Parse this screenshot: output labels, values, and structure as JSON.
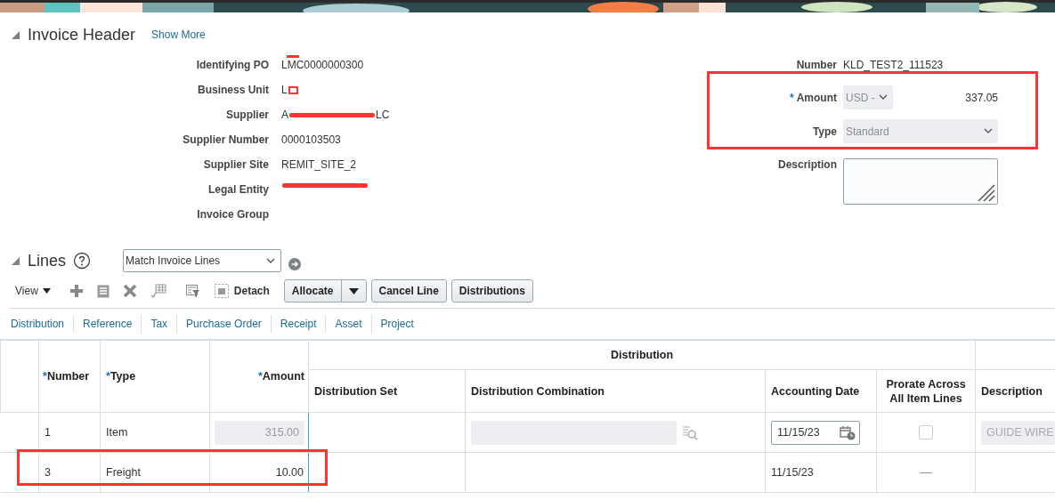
{
  "header": {
    "title": "Invoice Header",
    "expanded": true,
    "link": "Show More"
  },
  "left_fields": [
    {
      "kind": "redact-top",
      "label": "Identifying PO",
      "value": "LMC0000000300"
    },
    {
      "kind": "redact-box",
      "label": "Business Unit",
      "value": "L"
    },
    {
      "kind": "redact-strike",
      "label": "Supplier",
      "value": "A",
      "value_after": "LC"
    },
    {
      "kind": "plain",
      "label": "Supplier Number",
      "value": "0000103503"
    },
    {
      "kind": "plain",
      "label": "Supplier Site",
      "value": "REMIT_SITE_2"
    },
    {
      "kind": "redact-strike",
      "label": "Legal Entity"
    },
    {
      "kind": "plain",
      "label": "Invoice Group"
    }
  ],
  "right_fields": [
    {
      "kind": "text",
      "label": "Number",
      "value": "KLD_TEST2_111523",
      "highlighted": false
    },
    {
      "kind": "amount",
      "label": "Amount",
      "required_mark": "*",
      "currency": "USD -",
      "value": "337.05",
      "disabled": true,
      "highlighted": true
    },
    {
      "kind": "select",
      "label": "Type",
      "value": "Standard",
      "disabled": true,
      "highlighted": true
    },
    {
      "kind": "textarea",
      "label": "Description",
      "highlighted": false
    }
  ],
  "lines": {
    "title": "Lines",
    "expanded": true,
    "action_select": "Match Invoice Lines",
    "toolbar": {
      "view": "View",
      "detach": "Detach",
      "buttons": [
        {
          "label": "Allocate",
          "kind": "split"
        },
        {
          "label": "Cancel Line",
          "kind": "plain"
        },
        {
          "label": "Distributions",
          "kind": "plain"
        }
      ]
    },
    "tabs": [
      "Distribution",
      "Reference",
      "Tax",
      "Purchase Order",
      "Receipt",
      "Asset",
      "Project"
    ],
    "table": {
      "group_heading": "Distribution",
      "columns": [
        {
          "label": "Number",
          "required_mark": "*"
        },
        {
          "label": "Type",
          "required_mark": "*"
        },
        {
          "label": "Amount",
          "required_mark": "*"
        },
        {
          "label": "Distribution Set"
        },
        {
          "label": "Distribution Combination"
        },
        {
          "label": "Accounting Date"
        },
        {
          "label": "Prorate Across All Item Lines"
        },
        {
          "label": "Description"
        }
      ],
      "rows": [
        {
          "kind": "edit",
          "number": "1",
          "type": "Item",
          "amount": "315.00",
          "accounting_date": "11/15/23",
          "prorate_checked": false,
          "description": "GUIDE WIRE",
          "highlighted": false
        },
        {
          "kind": "read",
          "number": "3",
          "type": "Freight",
          "amount": "10.00",
          "accounting_date": "11/15/23",
          "prorate_text": "—",
          "highlighted": true
        }
      ]
    }
  }
}
